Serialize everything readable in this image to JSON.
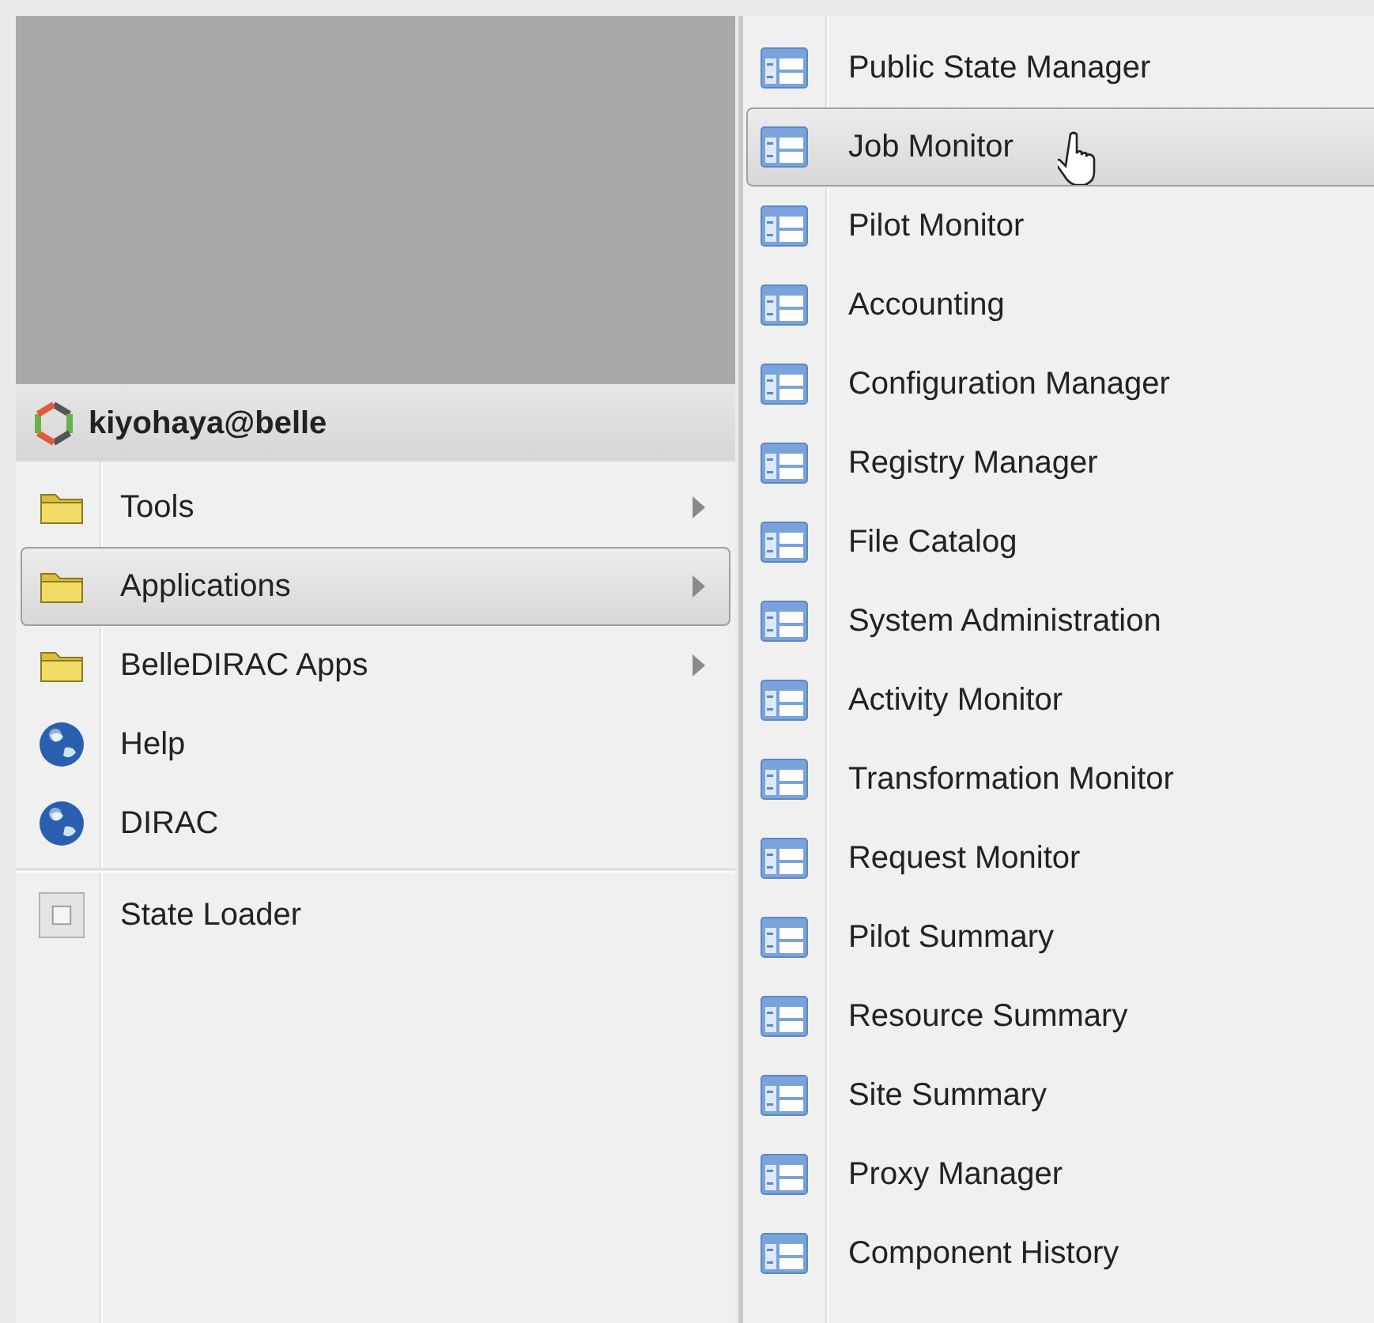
{
  "user_header": {
    "username": "kiyohaya@belle"
  },
  "main_menu": {
    "items": [
      {
        "label": "Tools",
        "kind": "folder",
        "has_submenu": true,
        "selected": false
      },
      {
        "label": "Applications",
        "kind": "folder",
        "has_submenu": true,
        "selected": true
      },
      {
        "label": "BelleDIRAC Apps",
        "kind": "folder",
        "has_submenu": true,
        "selected": false
      },
      {
        "label": "Help",
        "kind": "link",
        "has_submenu": false,
        "selected": false
      },
      {
        "label": "DIRAC",
        "kind": "link",
        "has_submenu": false,
        "selected": false
      },
      {
        "kind": "separator"
      },
      {
        "label": "State Loader",
        "kind": "state",
        "has_submenu": false,
        "selected": false
      }
    ]
  },
  "applications_menu": {
    "items": [
      {
        "label": "Public State Manager",
        "selected": false
      },
      {
        "label": "Job Monitor",
        "selected": true
      },
      {
        "label": "Pilot Monitor",
        "selected": false
      },
      {
        "label": "Accounting",
        "selected": false
      },
      {
        "label": "Configuration Manager",
        "selected": false
      },
      {
        "label": "Registry Manager",
        "selected": false
      },
      {
        "label": "File Catalog",
        "selected": false
      },
      {
        "label": "System Administration",
        "selected": false
      },
      {
        "label": "Activity Monitor",
        "selected": false
      },
      {
        "label": "Transformation Monitor",
        "selected": false
      },
      {
        "label": "Request Monitor",
        "selected": false
      },
      {
        "label": "Pilot Summary",
        "selected": false
      },
      {
        "label": "Resource Summary",
        "selected": false
      },
      {
        "label": "Site Summary",
        "selected": false
      },
      {
        "label": "Proxy Manager",
        "selected": false
      },
      {
        "label": "Component History",
        "selected": false
      }
    ]
  }
}
